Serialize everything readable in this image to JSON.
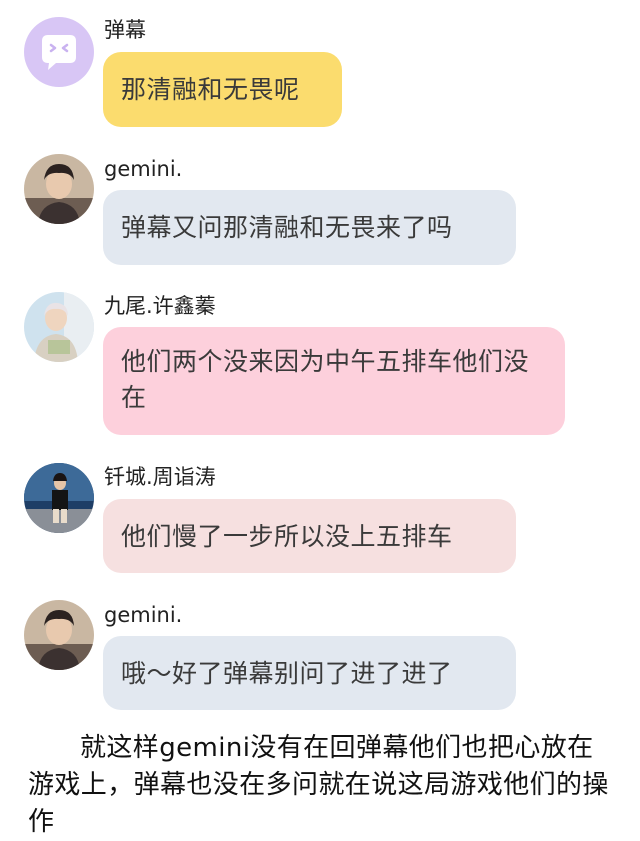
{
  "messages": [
    {
      "username": "弹幕",
      "text": "那清融和无畏呢",
      "bubble_color": "#fbdc6e",
      "avatar_icon": "danmu-chat-icon",
      "avatar_color": "#d8c6f5"
    },
    {
      "username": "gemini.",
      "text": "弹幕又问那清融和无畏来了吗",
      "bubble_color": "#e2e8f0",
      "avatar_icon": "user-photo-avatar"
    },
    {
      "username": "九尾.许鑫蓁",
      "text": "他们两个没来因为中午五排车他们没在",
      "bubble_color": "#fdd0dc",
      "avatar_icon": "user-photo-avatar"
    },
    {
      "username": "钎城.周诣涛",
      "text": "他们慢了一步所以没上五排车",
      "bubble_color": "#f6e0e0",
      "avatar_icon": "user-photo-avatar"
    },
    {
      "username": "gemini.",
      "text": "哦～好了弹幕别问了进了进了",
      "bubble_color": "#e2e8f0",
      "avatar_icon": "user-photo-avatar"
    }
  ],
  "narration": "就这样gemini没有在回弹幕他们也把心放在游戏上，弹幕也没在多问就在说这局游戏他们的操作"
}
